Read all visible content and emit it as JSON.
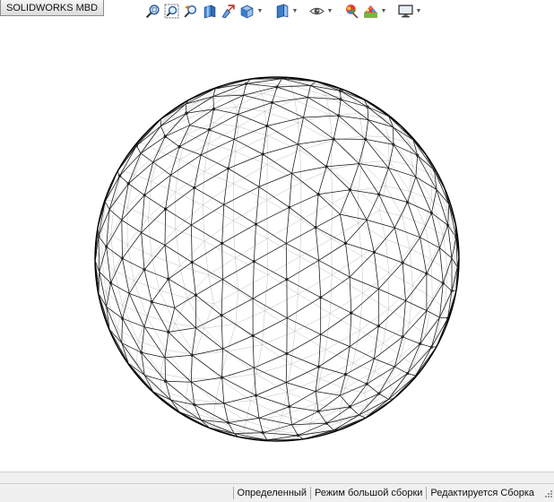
{
  "tab": {
    "label": "SOLIDWORKS MBD"
  },
  "toolbar": {
    "items": [
      {
        "icon": "zoom-to-fit-icon",
        "dropdown": false
      },
      {
        "icon": "zoom-to-area-icon",
        "dropdown": false
      },
      {
        "icon": "previous-view-icon",
        "dropdown": false
      },
      {
        "icon": "section-view-icon",
        "dropdown": false
      },
      {
        "icon": "dynamic-annotation-views-icon",
        "dropdown": false
      },
      {
        "icon": "view-orientation-icon",
        "dropdown": true
      },
      {
        "icon": "display-style-icon",
        "dropdown": true
      },
      {
        "icon": "hide-show-items-icon",
        "dropdown": true
      },
      {
        "icon": "edit-appearance-icon",
        "dropdown": false
      },
      {
        "icon": "apply-scene-icon",
        "dropdown": true
      },
      {
        "icon": "view-settings-icon",
        "dropdown": true
      }
    ]
  },
  "status": {
    "state": "Определенный",
    "mode": "Режим большой сборки",
    "editing": "Редактируется Сборка"
  }
}
